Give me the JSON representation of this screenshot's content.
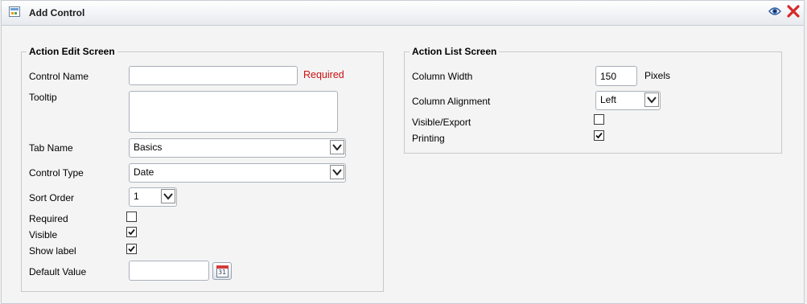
{
  "window": {
    "title": "Add Control",
    "icons": {
      "app": "form-icon",
      "preview": "eye-icon",
      "close": "close-x-icon"
    }
  },
  "edit_screen": {
    "legend": "Action Edit Screen",
    "control_name": {
      "label": "Control Name",
      "value": "",
      "required_note": "Required"
    },
    "tooltip": {
      "label": "Tooltip",
      "value": ""
    },
    "tab_name": {
      "label": "Tab Name",
      "selected": "Basics"
    },
    "control_type": {
      "label": "Control Type",
      "selected": "Date"
    },
    "sort_order": {
      "label": "Sort Order",
      "selected": "1"
    },
    "required": {
      "label": "Required",
      "checked": false
    },
    "visible": {
      "label": "Visible",
      "checked": true
    },
    "show_label": {
      "label": "Show label",
      "checked": true
    },
    "default_value": {
      "label": "Default Value",
      "value": "",
      "icon": "calendar-icon",
      "icon_text": "31"
    }
  },
  "list_screen": {
    "legend": "Action List Screen",
    "column_width": {
      "label": "Column Width",
      "value": "150",
      "unit": "Pixels"
    },
    "column_alignment": {
      "label": "Column Alignment",
      "selected": "Left"
    },
    "visible_export": {
      "label": "Visible/Export",
      "checked": false
    },
    "printing": {
      "label": "Printing",
      "checked": true
    }
  },
  "colors": {
    "required_red": "#cc1111",
    "close_red": "#d42a2a"
  }
}
